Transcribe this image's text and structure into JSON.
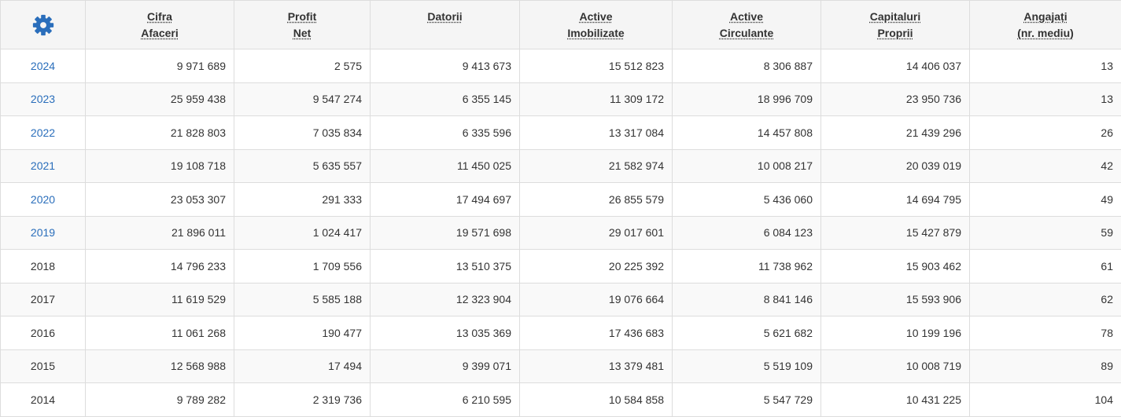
{
  "colors": {
    "accent": "#2a6ebb",
    "header_bg": "#f5f5f5",
    "stripe_bg": "#f9f9f9",
    "border": "#dddddd",
    "text": "#333333"
  },
  "settings_icon": "gear-icon",
  "headers": [
    {
      "line1": "Cifra",
      "line2": "Afaceri"
    },
    {
      "line1": "Profit",
      "line2": "Net"
    },
    {
      "line1": "Datorii",
      "line2": ""
    },
    {
      "line1": "Active",
      "line2": "Imobilizate"
    },
    {
      "line1": "Active",
      "line2": "Circulante"
    },
    {
      "line1": "Capitaluri",
      "line2": "Proprii"
    },
    {
      "line1": "Angajați",
      "line2": "(nr. mediu)"
    }
  ],
  "rows": [
    {
      "year": "2024",
      "link": true,
      "values": [
        "9 971 689",
        "2 575",
        "9 413 673",
        "15 512 823",
        "8 306 887",
        "14 406 037",
        "13"
      ]
    },
    {
      "year": "2023",
      "link": true,
      "values": [
        "25 959 438",
        "9 547 274",
        "6 355 145",
        "11 309 172",
        "18 996 709",
        "23 950 736",
        "13"
      ]
    },
    {
      "year": "2022",
      "link": true,
      "values": [
        "21 828 803",
        "7 035 834",
        "6 335 596",
        "13 317 084",
        "14 457 808",
        "21 439 296",
        "26"
      ]
    },
    {
      "year": "2021",
      "link": true,
      "values": [
        "19 108 718",
        "5 635 557",
        "11 450 025",
        "21 582 974",
        "10 008 217",
        "20 039 019",
        "42"
      ]
    },
    {
      "year": "2020",
      "link": true,
      "values": [
        "23 053 307",
        "291 333",
        "17 494 697",
        "26 855 579",
        "5 436 060",
        "14 694 795",
        "49"
      ]
    },
    {
      "year": "2019",
      "link": true,
      "values": [
        "21 896 011",
        "1 024 417",
        "19 571 698",
        "29 017 601",
        "6 084 123",
        "15 427 879",
        "59"
      ]
    },
    {
      "year": "2018",
      "link": false,
      "values": [
        "14 796 233",
        "1 709 556",
        "13 510 375",
        "20 225 392",
        "11 738 962",
        "15 903 462",
        "61"
      ]
    },
    {
      "year": "2017",
      "link": false,
      "values": [
        "11 619 529",
        "5 585 188",
        "12 323 904",
        "19 076 664",
        "8 841 146",
        "15 593 906",
        "62"
      ]
    },
    {
      "year": "2016",
      "link": false,
      "values": [
        "11 061 268",
        "190 477",
        "13 035 369",
        "17 436 683",
        "5 621 682",
        "10 199 196",
        "78"
      ]
    },
    {
      "year": "2015",
      "link": false,
      "values": [
        "12 568 988",
        "17 494",
        "9 399 071",
        "13 379 481",
        "5 519 109",
        "10 008 719",
        "89"
      ]
    },
    {
      "year": "2014",
      "link": false,
      "values": [
        "9 789 282",
        "2 319 736",
        "6 210 595",
        "10 584 858",
        "5 547 729",
        "10 431 225",
        "104"
      ]
    }
  ]
}
